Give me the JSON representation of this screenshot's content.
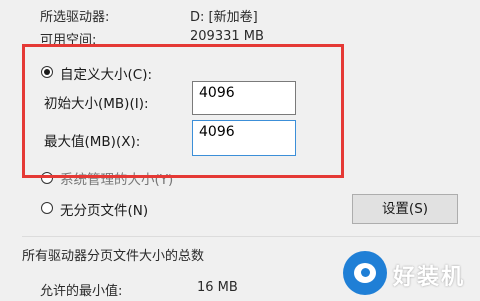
{
  "drive_info": {
    "selected_drive_label": "所选驱动器:",
    "selected_drive_value": "D: [新加卷]",
    "available_space_label": "可用空间:",
    "available_space_value": "209331 MB"
  },
  "paging_options": {
    "custom_size_label": "自定义大小(C):",
    "initial_size_label": "初始大小(MB)(I):",
    "initial_size_value": "4096",
    "max_size_label": "最大值(MB)(X):",
    "max_size_value": "4096",
    "system_managed_label": "系统管理的大小(Y)",
    "no_paging_label": "无分页文件(N)",
    "set_button_label": "设置(S)",
    "selected_option": "custom"
  },
  "totals": {
    "section_title": "所有驱动器分页文件大小的总数",
    "min_allowed_label": "允许的最小值:",
    "min_allowed_value": "16 MB"
  },
  "watermark": {
    "text": "好装机",
    "color": "#1f7fd6"
  },
  "colors": {
    "highlight_border": "#e53935",
    "focus_border": "#3c8fd8"
  }
}
